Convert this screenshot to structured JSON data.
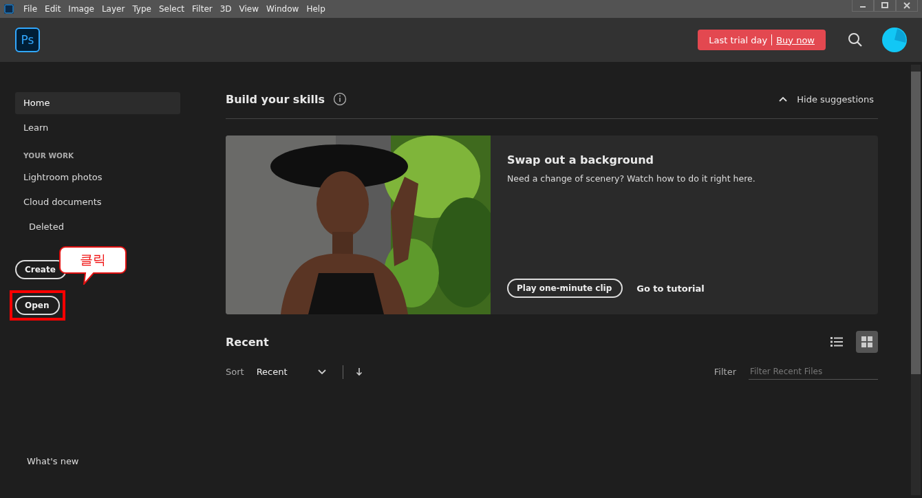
{
  "menu_bar": [
    "File",
    "Edit",
    "Image",
    "Layer",
    "Type",
    "Select",
    "Filter",
    "3D",
    "View",
    "Window",
    "Help"
  ],
  "header": {
    "logo": "Ps",
    "trial": {
      "status": "Last trial day",
      "link": "Buy now"
    }
  },
  "sidebar": {
    "items": [
      {
        "label": "Home",
        "selected": true
      },
      {
        "label": "Learn",
        "selected": false
      }
    ],
    "section": "YOUR WORK",
    "work_items": [
      {
        "label": "Lightroom photos",
        "selected": false
      },
      {
        "label": "Cloud documents",
        "selected": false,
        "children": [
          {
            "label": "Deleted",
            "selected": false
          }
        ]
      }
    ],
    "buttons": [
      {
        "label": "Create",
        "highlighted": false
      },
      {
        "label": "Open",
        "highlighted": true
      }
    ],
    "footer_link": "What's new"
  },
  "callout": {
    "text": "클릭"
  },
  "skills": {
    "title": "Build your skills",
    "toggle": "Hide suggestions",
    "card": {
      "title": "Swap out a background",
      "description": "Need a change of scenery? Watch how to do it right here.",
      "primary": "Play one-minute clip",
      "secondary": "Go to tutorial"
    }
  },
  "recent": {
    "title": "Recent",
    "views": [
      {
        "kind": "list",
        "selected": false
      },
      {
        "kind": "grid",
        "selected": true
      }
    ],
    "sort_label": "Sort",
    "sort_value": "Recent",
    "filter_label": "Filter",
    "filter_placeholder": "Filter Recent Files"
  }
}
